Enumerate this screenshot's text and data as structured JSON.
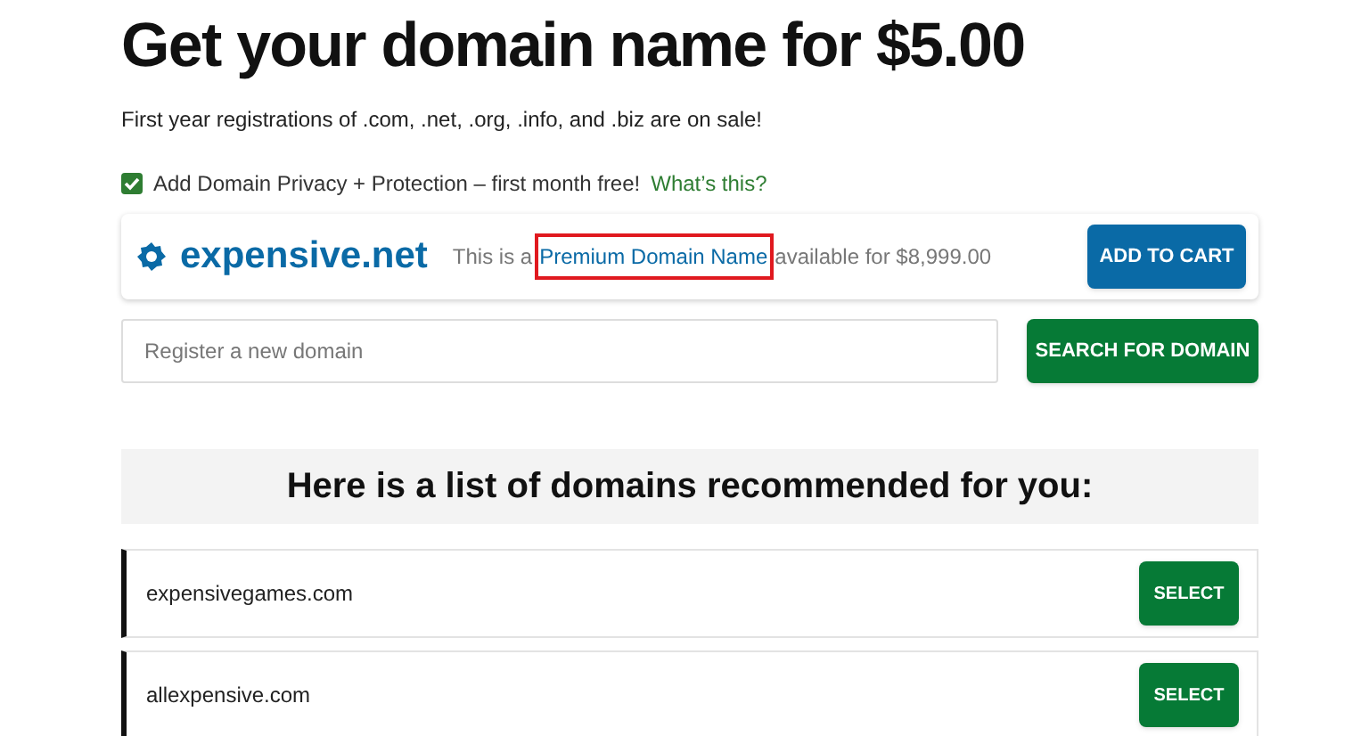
{
  "heading": "Get your domain name for $5.00",
  "subtitle": "First year registrations of .com, .net, .org, .info, and .biz are on sale!",
  "privacy": {
    "checked": true,
    "label": "Add Domain Privacy + Protection – first month free!",
    "link": "What’s this?"
  },
  "premium": {
    "domain": "expensive.net",
    "before": "This is a",
    "link": "Premium Domain Name",
    "highlighted": true,
    "after": "available for $8,999.00",
    "button": "ADD TO CART"
  },
  "search": {
    "placeholder": "Register a new domain",
    "button": "SEARCH FOR DOMAIN"
  },
  "recommended": {
    "title": "Here is a list of domains recommended for you:",
    "rows": [
      {
        "domain": "expensivegames.com",
        "button": "SELECT"
      },
      {
        "domain": "allexpensive.com",
        "button": "SELECT"
      }
    ]
  }
}
